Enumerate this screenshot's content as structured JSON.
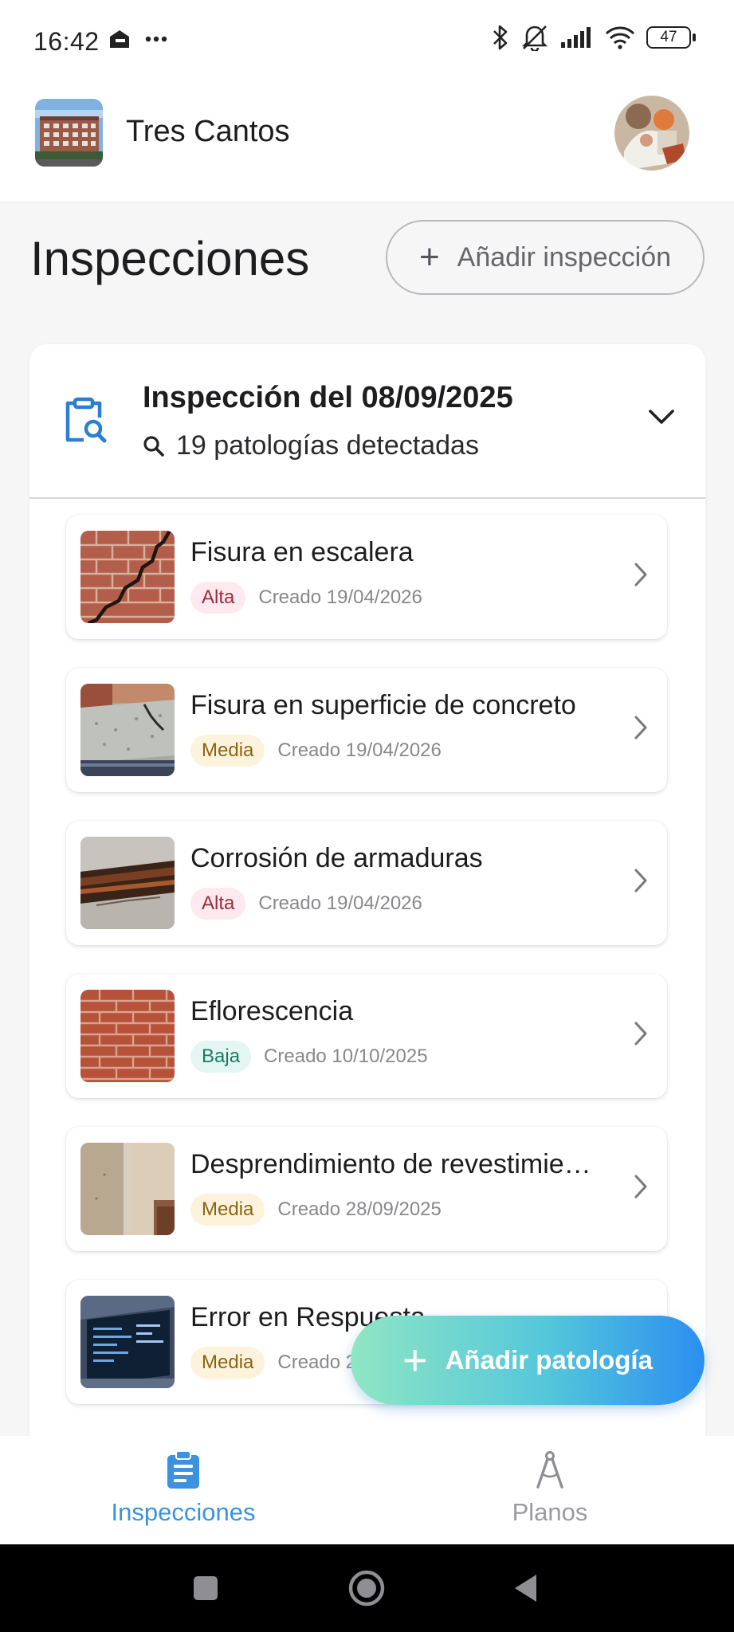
{
  "status_bar": {
    "time": "16:42",
    "battery": "47"
  },
  "header": {
    "project_name": "Tres Cantos"
  },
  "page": {
    "title": "Inspecciones",
    "add_inspection_label": "Añadir inspección"
  },
  "inspection": {
    "title": "Inspección del 08/09/2025",
    "count_label": "19 patologías detectadas",
    "items": [
      {
        "title": "Fisura en escalera",
        "severity": "Alta",
        "severity_class": "alta",
        "created": "Creado 19/04/2026"
      },
      {
        "title": "Fisura en superficie de concreto",
        "severity": "Media",
        "severity_class": "media",
        "created": "Creado 19/04/2026"
      },
      {
        "title": "Corrosión de armaduras",
        "severity": "Alta",
        "severity_class": "alta",
        "created": "Creado 19/04/2026"
      },
      {
        "title": "Eflorescencia",
        "severity": "Baja",
        "severity_class": "baja",
        "created": "Creado 10/10/2025"
      },
      {
        "title": "Desprendimiento de revestimie…",
        "severity": "Media",
        "severity_class": "media",
        "created": "Creado 28/09/2025"
      },
      {
        "title": "Error en Respuesta",
        "severity": "Media",
        "severity_class": "media",
        "created": "Creado 28/09/2025"
      }
    ]
  },
  "fab": {
    "label": "Añadir patología"
  },
  "bottom_nav": {
    "inspecciones_label": "Inspecciones",
    "planos_label": "Planos"
  },
  "colors": {
    "accent": "#3b93dd",
    "alta": "#9c2a3e",
    "media": "#8a6510",
    "baja": "#1d7a62"
  }
}
